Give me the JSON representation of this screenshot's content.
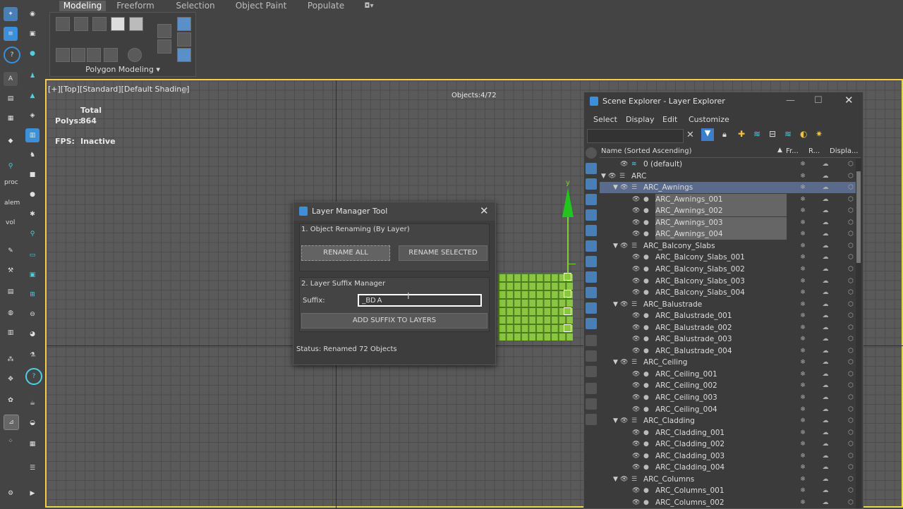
{
  "ribbon": {
    "tabs": [
      {
        "label": "Modeling",
        "active": true
      },
      {
        "label": "Freeform"
      },
      {
        "label": "Selection"
      },
      {
        "label": "Object Paint"
      },
      {
        "label": "Populate"
      }
    ],
    "panel_label": "Polygon Modeling"
  },
  "viewport": {
    "label": "[+][Top][Standard][Default Shading]",
    "objects": "Objects:4/72",
    "stats_total": "Total",
    "polys_label": "Polys:",
    "polys_value": "864",
    "fps_label": "FPS:",
    "fps_value": "Inactive",
    "axis_y": "y"
  },
  "left_tools": {
    "proc": "proc",
    "alem": "alem",
    "vol": "vol"
  },
  "dialog": {
    "title": "Layer Manager Tool",
    "section1": "1. Object Renaming (By Layer)",
    "rename_all": "RENAME ALL",
    "rename_selected": "RENAME SELECTED",
    "section2": "2. Layer Suffix Manager",
    "suffix_label": "Suffix:",
    "suffix_value": "_BD A",
    "add_suffix": "ADD SUFFIX TO LAYERS",
    "status": "Status: Renamed 72 Objects"
  },
  "scene_explorer": {
    "title": "Scene Explorer - Layer Explorer",
    "menu": [
      "Select",
      "Display",
      "Edit",
      "Customize"
    ],
    "columns": {
      "name": "Name (Sorted Ascending)",
      "fr": "Fr...",
      "r": "R...",
      "disp": "Displa..."
    },
    "rows": [
      {
        "label": "0 (default)",
        "level": 1,
        "type": "layer"
      },
      {
        "label": "ARC",
        "level": 0,
        "type": "layer"
      },
      {
        "label": "ARC_Awnings",
        "level": 1,
        "type": "layer",
        "selected": true
      },
      {
        "label": "ARC_Awnings_001",
        "level": 2,
        "type": "obj",
        "selected": true
      },
      {
        "label": "ARC_Awnings_002",
        "level": 2,
        "type": "obj",
        "selected": true
      },
      {
        "label": "ARC_Awnings_003",
        "level": 2,
        "type": "obj",
        "selected": true
      },
      {
        "label": "ARC_Awnings_004",
        "level": 2,
        "type": "obj",
        "selected": true
      },
      {
        "label": "ARC_Balcony_Slabs",
        "level": 1,
        "type": "layer"
      },
      {
        "label": "ARC_Balcony_Slabs_001",
        "level": 2,
        "type": "obj"
      },
      {
        "label": "ARC_Balcony_Slabs_002",
        "level": 2,
        "type": "obj"
      },
      {
        "label": "ARC_Balcony_Slabs_003",
        "level": 2,
        "type": "obj"
      },
      {
        "label": "ARC_Balcony_Slabs_004",
        "level": 2,
        "type": "obj"
      },
      {
        "label": "ARC_Balustrade",
        "level": 1,
        "type": "layer"
      },
      {
        "label": "ARC_Balustrade_001",
        "level": 2,
        "type": "obj"
      },
      {
        "label": "ARC_Balustrade_002",
        "level": 2,
        "type": "obj"
      },
      {
        "label": "ARC_Balustrade_003",
        "level": 2,
        "type": "obj"
      },
      {
        "label": "ARC_Balustrade_004",
        "level": 2,
        "type": "obj"
      },
      {
        "label": "ARC_Ceiling",
        "level": 1,
        "type": "layer"
      },
      {
        "label": "ARC_Ceiling_001",
        "level": 2,
        "type": "obj"
      },
      {
        "label": "ARC_Ceiling_002",
        "level": 2,
        "type": "obj"
      },
      {
        "label": "ARC_Ceiling_003",
        "level": 2,
        "type": "obj"
      },
      {
        "label": "ARC_Ceiling_004",
        "level": 2,
        "type": "obj"
      },
      {
        "label": "ARC_Cladding",
        "level": 1,
        "type": "layer"
      },
      {
        "label": "ARC_Cladding_001",
        "level": 2,
        "type": "obj"
      },
      {
        "label": "ARC_Cladding_002",
        "level": 2,
        "type": "obj"
      },
      {
        "label": "ARC_Cladding_003",
        "level": 2,
        "type": "obj"
      },
      {
        "label": "ARC_Cladding_004",
        "level": 2,
        "type": "obj"
      },
      {
        "label": "ARC_Columns",
        "level": 1,
        "type": "layer"
      },
      {
        "label": "ARC_Columns_001",
        "level": 2,
        "type": "obj"
      },
      {
        "label": "ARC_Columns_002",
        "level": 2,
        "type": "obj"
      }
    ]
  },
  "colors": {
    "viewport_border": "#f0d24b",
    "selected_row": "#5a6a8a",
    "selected_obj": "#6a6a6a",
    "green_object": "#8ac640",
    "accent_blue": "#3c8fd8"
  }
}
